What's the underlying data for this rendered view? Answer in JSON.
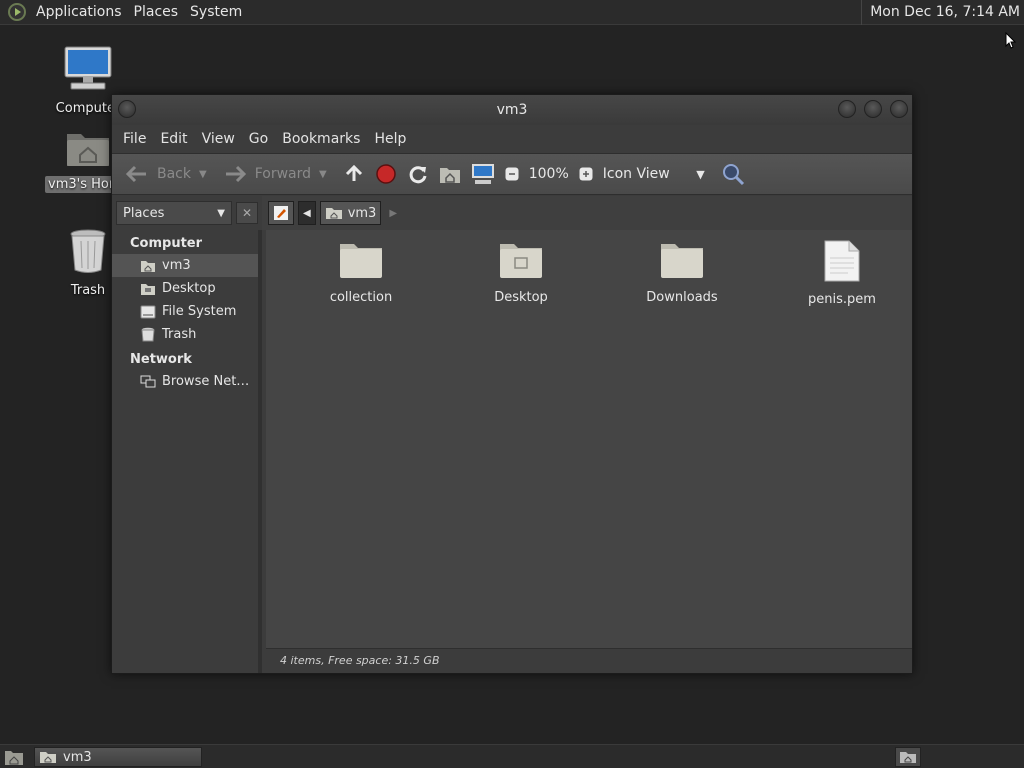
{
  "top_panel": {
    "menus": [
      "Applications",
      "Places",
      "System"
    ],
    "clock": "Mon Dec 16,  7:14 AM"
  },
  "desktop": {
    "icons": [
      {
        "label": "Computer",
        "icon": "computer-icon"
      },
      {
        "label": "vm3's Home",
        "icon": "home-folder-icon",
        "selected": true
      },
      {
        "label": "Trash",
        "icon": "trash-icon"
      }
    ]
  },
  "window": {
    "title": "vm3",
    "menu": [
      "File",
      "Edit",
      "View",
      "Go",
      "Bookmarks",
      "Help"
    ],
    "toolbar": {
      "back": "Back",
      "forward": "Forward",
      "zoom": "100%",
      "view_mode": "Icon View"
    },
    "places_select": "Places",
    "path": "vm3",
    "sidebar": {
      "computer_heading": "Computer",
      "computer_items": [
        {
          "label": "vm3",
          "icon": "home-icon",
          "selected": true
        },
        {
          "label": "Desktop",
          "icon": "desktop-folder-icon"
        },
        {
          "label": "File System",
          "icon": "drive-icon"
        },
        {
          "label": "Trash",
          "icon": "trash-icon"
        }
      ],
      "network_heading": "Network",
      "network_items": [
        {
          "label": "Browse Net…",
          "icon": "network-icon"
        }
      ]
    },
    "files": [
      {
        "name": "collection",
        "type": "folder"
      },
      {
        "name": "Desktop",
        "type": "desktop-folder"
      },
      {
        "name": "Downloads",
        "type": "folder"
      },
      {
        "name": "penis.pem",
        "type": "file"
      }
    ],
    "status": "4 items, Free space: 31.5 GB"
  },
  "bottom_panel": {
    "task": "vm3"
  },
  "colors": {
    "desktop_bg": "#232323",
    "folder": "#d8d6cb",
    "stop_red": "#c62828"
  }
}
